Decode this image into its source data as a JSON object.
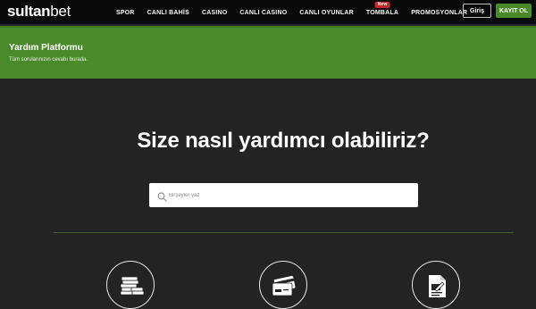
{
  "brand": {
    "logo_main": "sultan",
    "logo_accent": "bet"
  },
  "nav": {
    "items": [
      {
        "label": "SPOR"
      },
      {
        "label": "CANLI BAHİS"
      },
      {
        "label": "CASINO"
      },
      {
        "label": "CANLI CASINO"
      },
      {
        "label": "CANLI OYUNLAR"
      },
      {
        "label": "TOMBALA",
        "badge": "New"
      },
      {
        "label": "PROMOSYONLAR"
      }
    ]
  },
  "auth": {
    "login_label": "Giriş",
    "signup_label": "KAYIT OL"
  },
  "hero": {
    "title": "Yardım Platformu",
    "subtitle": "Tüm sorularınızın cevabı burada."
  },
  "main": {
    "heading": "Size nasıl yardımcı olabiliriz?"
  },
  "search": {
    "placeholder": "Birşeyler yaz"
  },
  "categories": [
    {
      "icon": "stacked-coins-icon"
    },
    {
      "icon": "credit-card-icon"
    },
    {
      "icon": "document-icon"
    }
  ],
  "colors": {
    "topbar_bg": "#0a0a0a",
    "page_bg": "#232323",
    "accent_green": "#4a8a2b",
    "badge_red": "#c62828"
  }
}
